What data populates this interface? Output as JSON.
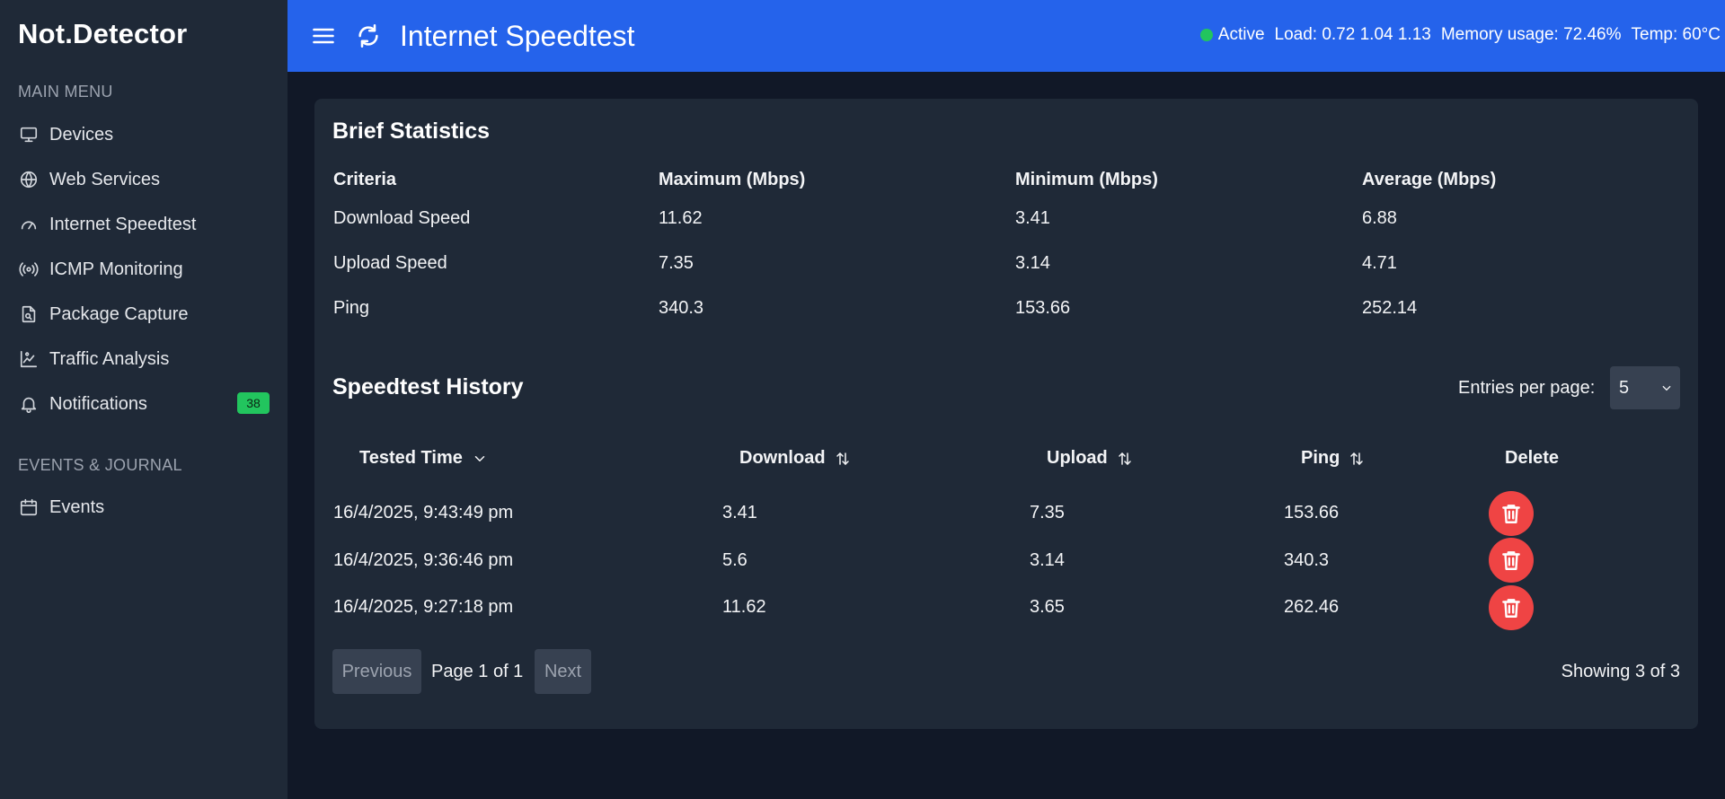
{
  "sidebar": {
    "brand": "Not.Detector",
    "main_menu_title": "MAIN MENU",
    "items": [
      {
        "label": "Devices",
        "icon": "monitor-icon"
      },
      {
        "label": "Web Services",
        "icon": "globe-icon"
      },
      {
        "label": "Internet Speedtest",
        "icon": "gauge-icon"
      },
      {
        "label": "ICMP Monitoring",
        "icon": "radio-icon"
      },
      {
        "label": "Package Capture",
        "icon": "file-search-icon"
      },
      {
        "label": "Traffic Analysis",
        "icon": "chart-icon"
      },
      {
        "label": "Notifications",
        "icon": "bell-icon",
        "badge": "38"
      }
    ],
    "events_title": "EVENTS & JOURNAL",
    "events_items": [
      {
        "label": "Events",
        "icon": "calendar-icon"
      }
    ]
  },
  "header": {
    "title": "Internet Speedtest",
    "status": "Active",
    "load": "Load: 0.72 1.04 1.13",
    "memory": "Memory usage: 72.46%",
    "temp": "Temp: 60°C"
  },
  "brief": {
    "title": "Brief Statistics",
    "columns": [
      "Criteria",
      "Maximum (Mbps)",
      "Minimum (Mbps)",
      "Average (Mbps)"
    ],
    "rows": [
      [
        "Download Speed",
        "11.62",
        "3.41",
        "6.88"
      ],
      [
        "Upload Speed",
        "7.35",
        "3.14",
        "4.71"
      ],
      [
        "Ping",
        "340.3",
        "153.66",
        "252.14"
      ]
    ]
  },
  "history": {
    "title": "Speedtest History",
    "entries_label": "Entries per page:",
    "entries_value": "5",
    "columns": [
      "Tested Time",
      "Download",
      "Upload",
      "Ping",
      "Delete"
    ],
    "rows": [
      [
        "16/4/2025, 9:43:49 pm",
        "3.41",
        "7.35",
        "153.66"
      ],
      [
        "16/4/2025, 9:36:46 pm",
        "5.6",
        "3.14",
        "340.3"
      ],
      [
        "16/4/2025, 9:27:18 pm",
        "11.62",
        "3.65",
        "262.46"
      ]
    ],
    "previous": "Previous",
    "page": "Page 1 of 1",
    "next": "Next",
    "showing": "Showing 3 of 3"
  },
  "colors": {
    "accent": "#2563eb",
    "sidebar_bg": "#1f2937",
    "page_bg": "#111827",
    "status_active": "#22c55e",
    "delete": "#ef4444"
  }
}
